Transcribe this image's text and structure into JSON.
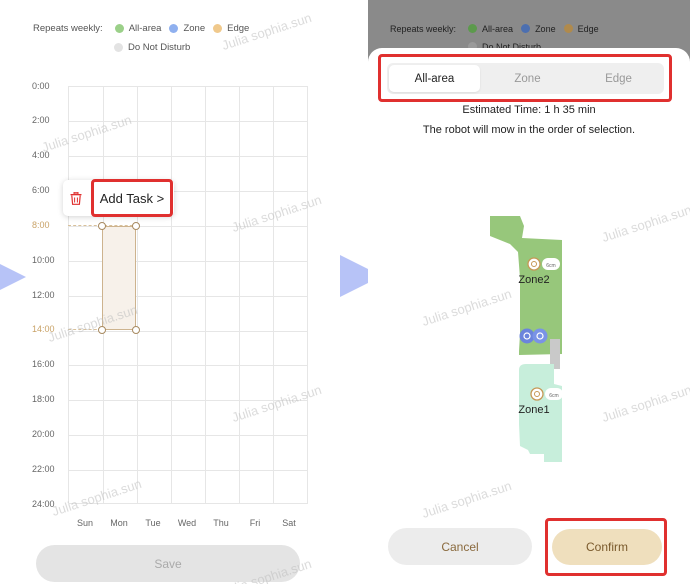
{
  "legend": {
    "title": "Repeats weekly:",
    "items": [
      {
        "label": "All-area",
        "color": "#9bd089"
      },
      {
        "label": "Zone",
        "color": "#8fb0ef"
      },
      {
        "label": "Edge",
        "color": "#f0c98c"
      },
      {
        "label": "Do Not Disturb",
        "color": "#e3e3e3"
      }
    ]
  },
  "schedule": {
    "times": [
      "0:00",
      "2:00",
      "4:00",
      "6:00",
      "8:00",
      "10:00",
      "12:00",
      "14:00",
      "16:00",
      "18:00",
      "20:00",
      "22:00",
      "24:00"
    ],
    "days": [
      "Sun",
      "Mon",
      "Tue",
      "Wed",
      "Thu",
      "Fri",
      "Sat"
    ],
    "selection": {
      "day": "Mon",
      "start": "8:00",
      "end": "14:00"
    }
  },
  "popup": {
    "add_task_label": "Add Task >"
  },
  "save_label": "Save",
  "sheet": {
    "tabs": [
      {
        "label": "All-area",
        "active": true
      },
      {
        "label": "Zone",
        "active": false
      },
      {
        "label": "Edge",
        "active": false
      }
    ],
    "estimated_time": "Estimated Time: 1 h 35 min",
    "order_note": "The robot will mow in the order of selection.",
    "map": {
      "zones": [
        {
          "name": "Zone2",
          "height_label": "6cm",
          "color": "#97c77b"
        },
        {
          "name": "Zone1",
          "height_label": "6cm",
          "color": "#c7eedb"
        }
      ]
    },
    "cancel_label": "Cancel",
    "confirm_label": "Confirm"
  },
  "watermark": "Julia sophia.sun"
}
